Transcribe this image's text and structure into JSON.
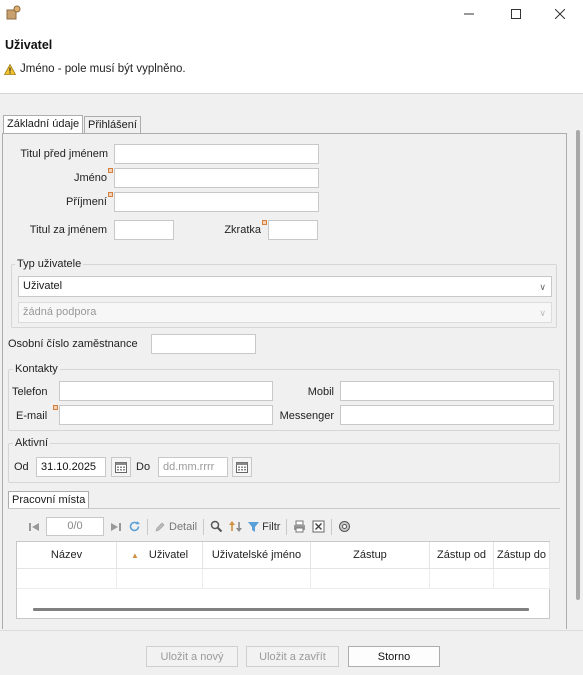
{
  "dialog": {
    "title": "Uživatel",
    "warning": "Jméno - pole musí být vyplněno."
  },
  "tabs": [
    {
      "label": "Základní údaje",
      "active": true
    },
    {
      "label": "Přihlášení",
      "active": false
    }
  ],
  "form": {
    "titul_pred_label": "Titul před jménem",
    "titul_pred_value": "",
    "jmeno_label": "Jméno",
    "jmeno_value": "",
    "prijmeni_label": "Příjmení",
    "prijmeni_value": "",
    "titul_za_label": "Titul za jménem",
    "titul_za_value": "",
    "zkratka_label": "Zkratka",
    "zkratka_value": "",
    "typ_group": "Typ uživatele",
    "typ_selected": "Uživatel",
    "podpora_selected": "žádná podpora",
    "osobni_cislo_label": "Osobní číslo zaměstnance",
    "osobni_cislo_value": ""
  },
  "kontakty": {
    "group": "Kontakty",
    "telefon_label": "Telefon",
    "email_label": "E-mail",
    "mobil_label": "Mobil",
    "messenger_label": "Messenger"
  },
  "aktivni": {
    "group": "Aktivní",
    "od_label": "Od",
    "od_value": "31.10.2025",
    "do_label": "Do",
    "do_placeholder": "dd.mm.rrrr"
  },
  "pracovni_mista": {
    "tab": "Pracovní místa",
    "page_counter": "0/0",
    "detail_label": "Detail",
    "filtr_label": "Filtr",
    "columns": [
      "Název",
      "Uživatel",
      "Uživatelské jméno",
      "Zástup",
      "Zástup od",
      "Zástup do"
    ]
  },
  "footer": {
    "ulozit_novy": "Uložit a nový",
    "ulozit_zavrit": "Uložit a zavřít",
    "storno": "Storno"
  },
  "colors": {
    "required_marker": "#f6d0b0",
    "warning": "#e0b020",
    "border": "#c8c8c8"
  }
}
